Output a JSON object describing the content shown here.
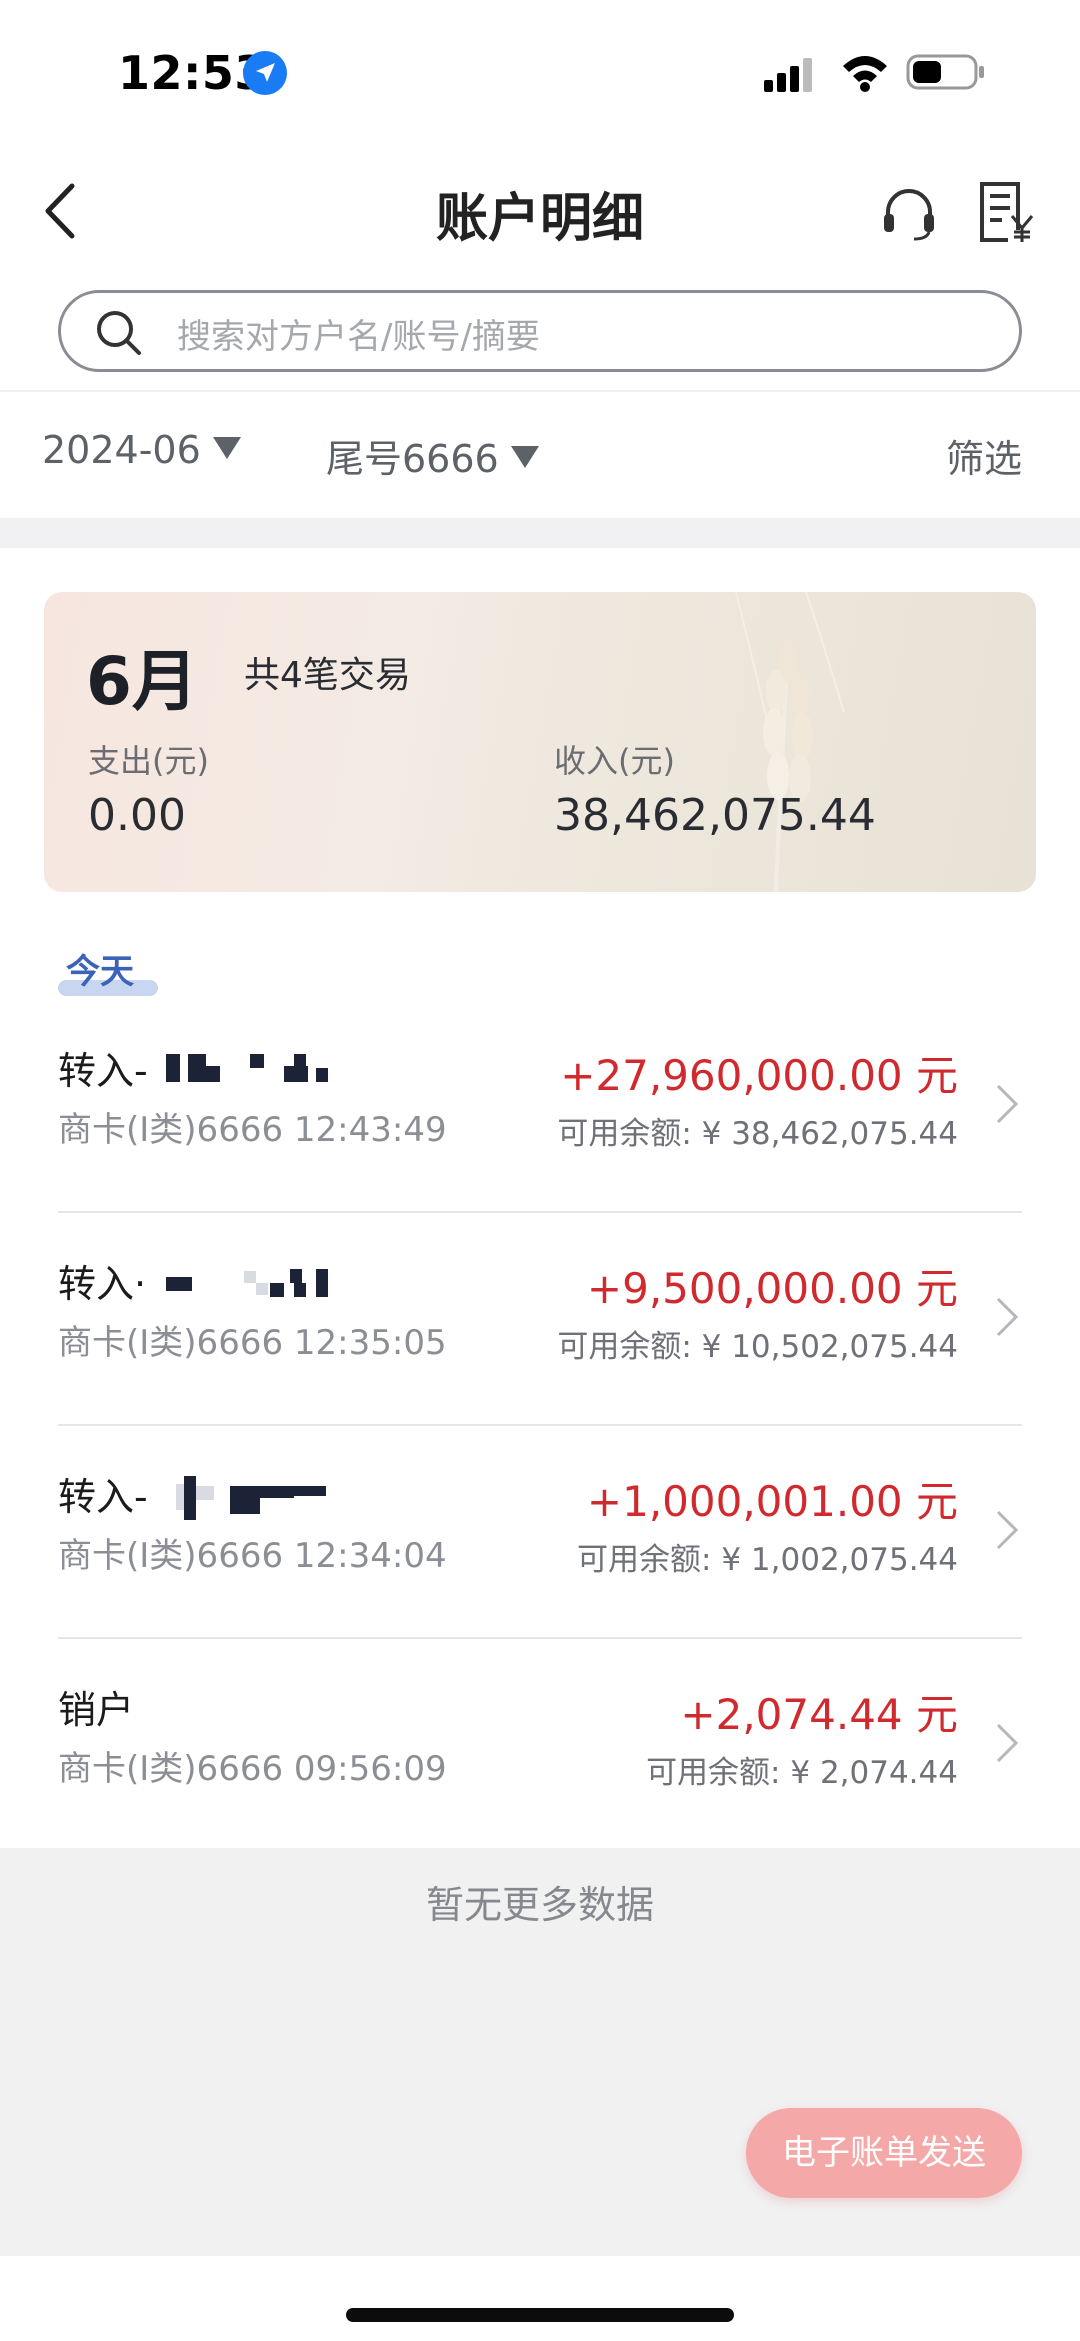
{
  "status_bar": {
    "time": "12:53"
  },
  "header": {
    "title": "账户明细"
  },
  "search": {
    "placeholder": "搜索对方户名/账号/摘要"
  },
  "filters": {
    "date": "2024-06",
    "card": "尾号6666",
    "filter_label": "筛选"
  },
  "summary": {
    "month": "6月",
    "count_text": "共4笔交易",
    "expense_label": "支出(元)",
    "expense_value": "0.00",
    "income_label": "收入(元)",
    "income_value": "38,462,075.44"
  },
  "section_label": "今天",
  "transactions": [
    {
      "type": "转入-",
      "meta": "商卡(Ⅰ类)6666 12:43:49",
      "amount": "+27,960,000.00 元",
      "balance": "可用余额: ¥ 38,462,075.44"
    },
    {
      "type": "转入·",
      "meta": "商卡(Ⅰ类)6666 12:35:05",
      "amount": "+9,500,000.00 元",
      "balance": "可用余额: ¥ 10,502,075.44"
    },
    {
      "type": "转入-",
      "meta": "商卡(Ⅰ类)6666 12:34:04",
      "amount": "+1,000,001.00 元",
      "balance": "可用余额: ¥ 1,002,075.44"
    },
    {
      "type": "销户",
      "meta": "商卡(Ⅰ类)6666 09:56:09",
      "amount": "+2,074.44 元",
      "balance": "可用余额: ¥ 2,074.44"
    }
  ],
  "footer": {
    "no_more": "暂无更多数据",
    "ebill_button": "电子账单发送"
  },
  "colors": {
    "amount_red": "#d12a2e",
    "accent_blue": "#3b64b8",
    "button_pink": "#f4a8a8"
  }
}
